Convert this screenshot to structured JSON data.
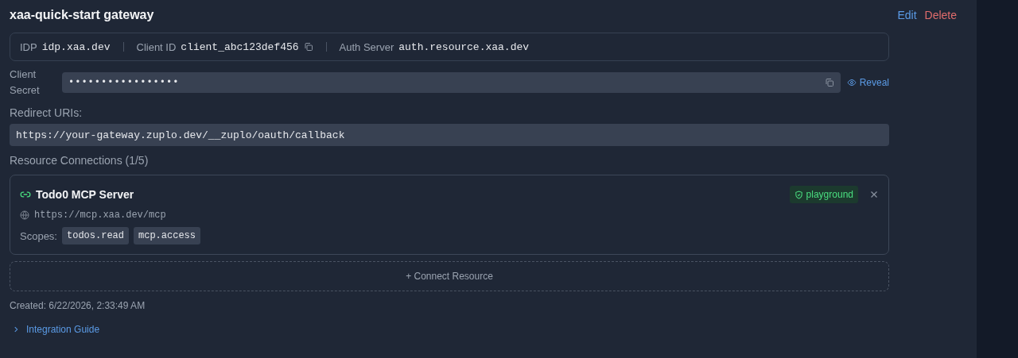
{
  "title": "xaa-quick-start gateway",
  "actions": [
    {
      "label": "Edit",
      "kind": "edit"
    },
    {
      "label": "Delete",
      "kind": "danger"
    }
  ],
  "info": [
    {
      "label": "IDP",
      "value": "idp.xaa.dev",
      "copyable": false
    },
    {
      "label": "Client ID",
      "value": "client_abc123def456",
      "copyable": true
    },
    {
      "label": "Auth Server",
      "value": "auth.resource.xaa.dev",
      "copyable": false
    }
  ],
  "secret": {
    "label": "Client Secret",
    "value": "•••••••••••••••••",
    "reveal": "Reveal"
  },
  "redirect": {
    "heading": "Redirect URIs:",
    "uri": "https://your-gateway.zuplo.dev/__zuplo/oauth/callback"
  },
  "resources": {
    "heading": "Resource Connections (1/5)",
    "items": [
      {
        "name": "Todo0 MCP Server",
        "url": "https://mcp.xaa.dev/mcp",
        "badge": "playground",
        "scopes_label": "Scopes:",
        "scopes": [
          "todos.read",
          "mcp.access"
        ]
      }
    ],
    "connect": "+ Connect Resource"
  },
  "created": "Created: 6/22/2026, 2:33:49 AM",
  "guide": {
    "label": "Integration Guide",
    "expanded": false
  }
}
